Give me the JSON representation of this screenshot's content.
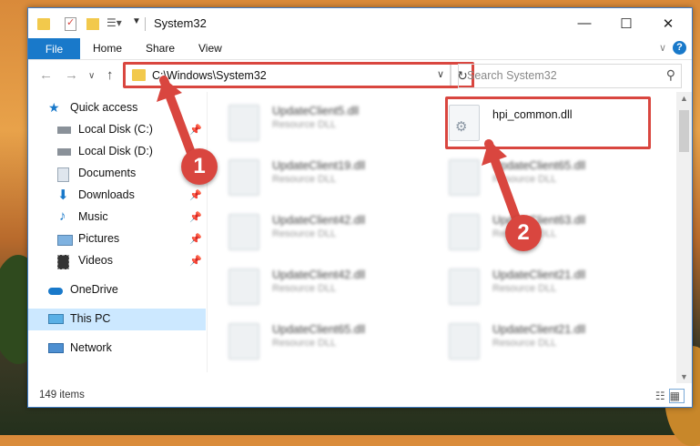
{
  "window": {
    "title": "System32",
    "controls": {
      "minimize": "—",
      "maximize": "☐",
      "close": "✕"
    }
  },
  "ribbon": {
    "file_tab": "File",
    "tabs": [
      "Home",
      "Share",
      "View"
    ],
    "help": "?"
  },
  "navigation": {
    "address": "C:\\Windows\\System32",
    "search_placeholder": "Search System32"
  },
  "sidebar": {
    "items": [
      {
        "label": "Quick access",
        "icon": "star-icon",
        "pinned": false
      },
      {
        "label": "Local Disk (C:)",
        "icon": "drive-icon",
        "pinned": true
      },
      {
        "label": "Local Disk (D:)",
        "icon": "drive-icon",
        "pinned": false
      },
      {
        "label": "Documents",
        "icon": "documents-icon",
        "pinned": true
      },
      {
        "label": "Downloads",
        "icon": "download-icon",
        "pinned": true
      },
      {
        "label": "Music",
        "icon": "music-icon",
        "pinned": true
      },
      {
        "label": "Pictures",
        "icon": "pictures-icon",
        "pinned": true
      },
      {
        "label": "Videos",
        "icon": "videos-icon",
        "pinned": true
      },
      {
        "label": "OneDrive",
        "icon": "cloud-icon",
        "pinned": false
      },
      {
        "label": "This PC",
        "icon": "computer-icon",
        "pinned": false,
        "selected": true
      },
      {
        "label": "Network",
        "icon": "network-icon",
        "pinned": false
      }
    ]
  },
  "files": [
    {
      "name": "UpdateClient5.dll",
      "type": "Resource DLL"
    },
    {
      "name": "hpi_common.dll",
      "type": ""
    },
    {
      "name": "UpdateClient19.dll",
      "type": "Resource DLL"
    },
    {
      "name": "UpdateClient65.dll",
      "type": "Resource DLL"
    },
    {
      "name": "UpdateClient42.dll",
      "type": "Resource DLL"
    },
    {
      "name": "UpdateClient63.dll",
      "type": "Resource DLL"
    },
    {
      "name": "UpdateClient42.dll",
      "type": "Resource DLL"
    },
    {
      "name": "UpdateClient21.dll",
      "type": "Resource DLL"
    },
    {
      "name": "UpdateClient65.dll",
      "type": "Resource DLL"
    },
    {
      "name": "UpdateClient21.dll",
      "type": "Resource DLL"
    }
  ],
  "status": {
    "item_count": "149 items"
  },
  "annotations": {
    "step1": "1",
    "step2": "2"
  },
  "colors": {
    "accent": "#1979ca",
    "highlight": "#d9463f",
    "selection": "#cce8ff"
  }
}
